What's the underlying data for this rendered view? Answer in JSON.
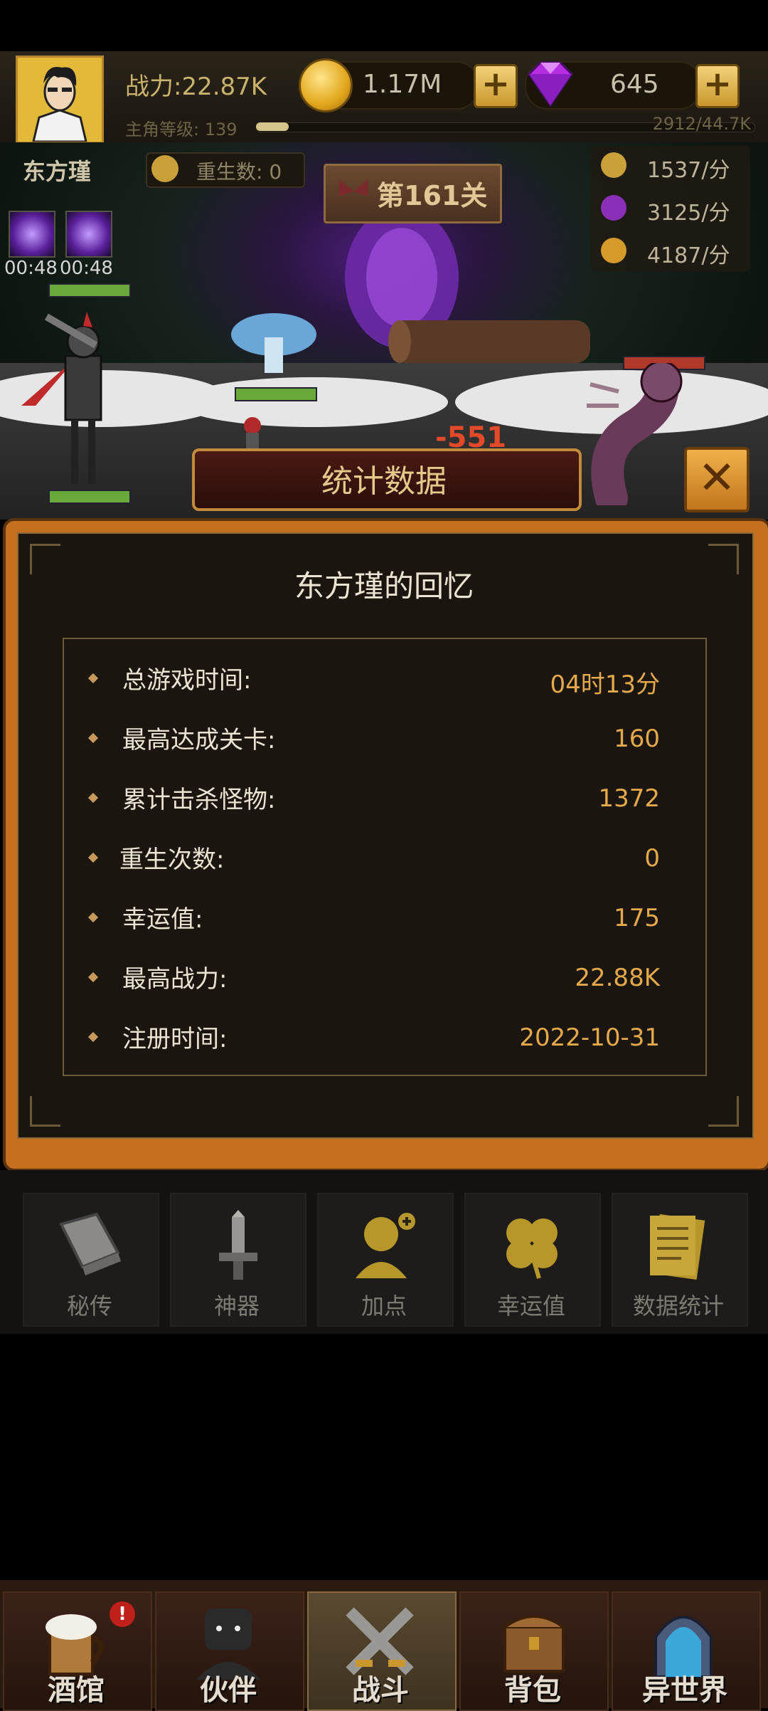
{
  "header": {
    "power": "战力:22.87K",
    "gold": "1.17M",
    "gems": "645",
    "level_label": "主角等级: 139",
    "level_progress": 0.065,
    "exp": "2912/44.7K"
  },
  "scene": {
    "player_name": "东方瑾",
    "rebirth": "重生数: 0",
    "stage": "第161关",
    "rates": [
      "1537/分",
      "3125/分",
      "4187/分"
    ],
    "buff_timers": [
      "00:48",
      "00:48"
    ],
    "damage": "-551"
  },
  "panel": {
    "title": "统计数据",
    "memory_title": "东方瑾的回忆",
    "stats": [
      {
        "label": "总游戏时间:",
        "value": "04时13分"
      },
      {
        "label": "最高达成关卡:",
        "value": "160"
      },
      {
        "label": "累计击杀怪物:",
        "value": "1372"
      },
      {
        "label": "重生次数:",
        "value": "0"
      },
      {
        "label": "幸运值:",
        "value": "175"
      },
      {
        "label": "最高战力:",
        "value": "22.88K"
      },
      {
        "label": "注册时间:",
        "value": "2022-10-31"
      }
    ]
  },
  "features": [
    "秘传",
    "神器",
    "加点",
    "幸运值",
    "数据统计"
  ],
  "nav": {
    "tabs": [
      "酒馆",
      "伙伴",
      "战斗",
      "背包",
      "异世界"
    ],
    "active": "战斗",
    "badge": "!"
  },
  "icons": {
    "gold": "gold-coin-icon",
    "gem": "purple-gem-icon",
    "close": "close-x-icon"
  },
  "colors": {
    "accent_orange": "#c4701f",
    "value_gold": "#e6a94a"
  }
}
